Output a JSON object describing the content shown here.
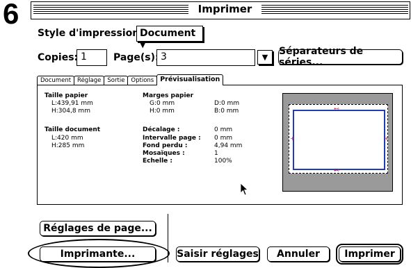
{
  "step_number": "6",
  "dialog": {
    "title": "Imprimer"
  },
  "style_impression": {
    "label": "Style d'impression:",
    "value": "Document",
    "arrow": "▼"
  },
  "copies": {
    "label": "Copies:",
    "value": "1"
  },
  "pages": {
    "label": "Page(s):",
    "value": "3",
    "arrow": "▼"
  },
  "separators_button": "Séparateurs de séries...",
  "tabs": [
    {
      "label": "Document"
    },
    {
      "label": "Réglage"
    },
    {
      "label": "Sortie"
    },
    {
      "label": "Options"
    },
    {
      "label": "Prévisualisation"
    }
  ],
  "preview": {
    "paper_size": {
      "label": "Taille papier",
      "width": "L:439,91  mm",
      "height": "H:304,8  mm"
    },
    "paper_margins": {
      "label": "Marges papier",
      "left": "G:0  mm",
      "right": "D:0  mm",
      "top": "H:0  mm",
      "bottom": "B:0  mm"
    },
    "doc_size": {
      "label": "Taille document",
      "width": "L:420  mm",
      "height": "H:285  mm"
    },
    "params": [
      {
        "label": "Décalage :",
        "value": "0  mm"
      },
      {
        "label": "Intervalle page :",
        "value": "0  mm"
      },
      {
        "label": "Fond perdu :",
        "value": "4,94  mm"
      },
      {
        "label": "Mosaïques :",
        "value": "1"
      },
      {
        "label": "Echelle :",
        "value": "100%"
      }
    ]
  },
  "buttons": {
    "page_setup": "Réglages de page...",
    "printer": "Imprimante...",
    "capture": "Saisir réglages",
    "cancel": "Annuler",
    "print": "Imprimer"
  },
  "colors": {
    "page_outline": "#1f3fb0",
    "marks": "#d81b60",
    "preview_bg": "#9a9a9a"
  }
}
